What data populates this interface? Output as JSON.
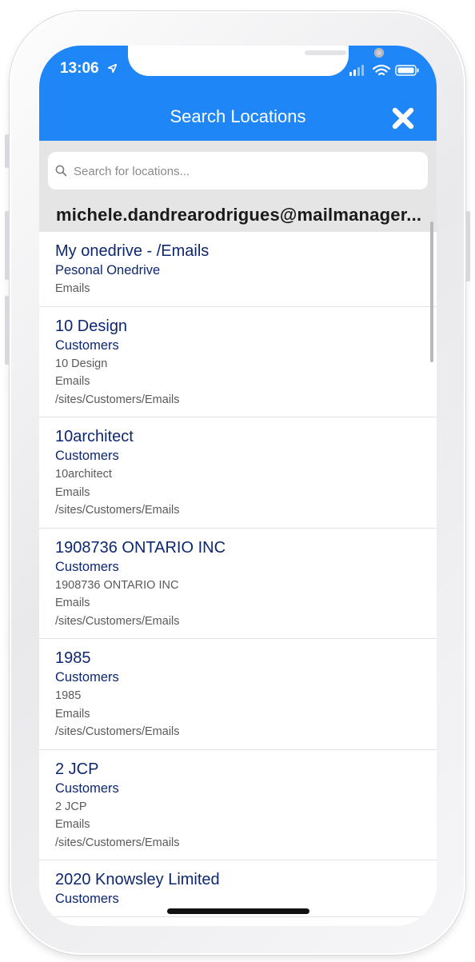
{
  "status_bar": {
    "time": "13:06"
  },
  "header": {
    "title": "Search Locations"
  },
  "search": {
    "placeholder": "Search for locations..."
  },
  "account": {
    "email": "michele.dandrearodrigues@mailmanager..."
  },
  "locations": [
    {
      "name": "My onedrive - /Emails",
      "site": "Pesonal Onedrive",
      "details": [
        "Emails"
      ]
    },
    {
      "name": "10 Design",
      "site": "Customers",
      "details": [
        "10 Design",
        "Emails",
        "/sites/Customers/Emails"
      ]
    },
    {
      "name": "10architect",
      "site": "Customers",
      "details": [
        "10architect",
        "Emails",
        "/sites/Customers/Emails"
      ]
    },
    {
      "name": "1908736 ONTARIO INC",
      "site": "Customers",
      "details": [
        "1908736 ONTARIO INC",
        "Emails",
        "/sites/Customers/Emails"
      ]
    },
    {
      "name": "1985",
      "site": "Customers",
      "details": [
        "1985",
        "Emails",
        "/sites/Customers/Emails"
      ]
    },
    {
      "name": "2 JCP",
      "site": "Customers",
      "details": [
        "2 JCP",
        "Emails",
        "/sites/Customers/Emails"
      ]
    },
    {
      "name": "2020 Knowsley Limited",
      "site": "Customers",
      "details": []
    }
  ]
}
